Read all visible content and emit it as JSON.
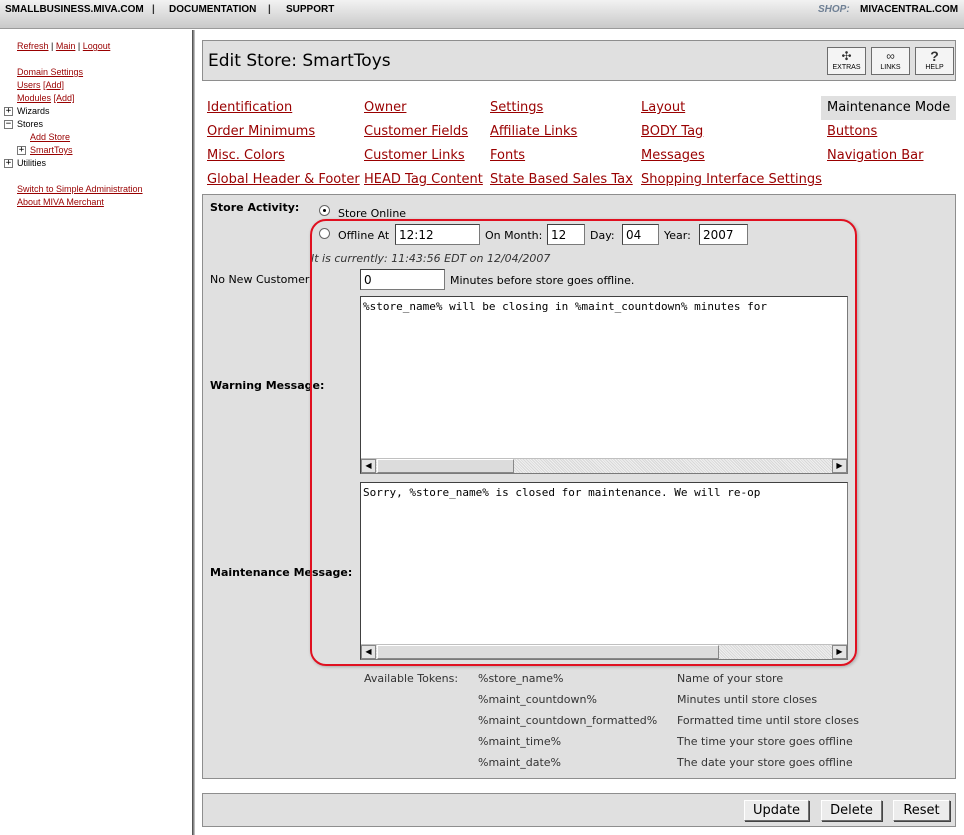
{
  "topbar": {
    "link1": "SMALLBUSINESS.MIVA.COM",
    "sep": "|",
    "link2": "DOCUMENTATION",
    "link3": "SUPPORT",
    "shop_label": "SHOP:",
    "shop_link": "MIVACENTRAL.COM"
  },
  "sidebar": {
    "refresh": "Refresh",
    "pipe": "|",
    "main": "Main",
    "logout": "Logout",
    "domain_settings": "Domain Settings",
    "users": "Users",
    "users_add": "[Add]",
    "modules": "Modules",
    "modules_add": "[Add]",
    "wizards": "Wizards",
    "stores": "Stores",
    "add_store": "Add Store",
    "smarttoys": "SmartToys",
    "utilities": "Utilities",
    "switch_simple": "Switch to Simple Administration",
    "about": "About MIVA Merchant",
    "plus_symbol": "+",
    "minus_symbol": "−"
  },
  "header": {
    "title": "Edit Store: SmartToys",
    "extras": "EXTRAS",
    "links": "LINKS",
    "help": "HELP",
    "help_icon": "?"
  },
  "tabs": {
    "identification": "Identification",
    "owner": "Owner",
    "settings": "Settings",
    "layout": "Layout",
    "maintenance_mode": "Maintenance Mode",
    "order_minimums": "Order Minimums",
    "customer_fields": "Customer Fields",
    "affiliate_links": "Affiliate Links",
    "body_tag": "BODY Tag",
    "buttons": "Buttons",
    "misc_colors": "Misc. Colors",
    "customer_links": "Customer Links",
    "fonts": "Fonts",
    "messages": "Messages",
    "navigation_bar": "Navigation Bar",
    "global_header_footer": "Global Header & Footer",
    "head_tag_content": "HEAD Tag Content",
    "state_based_sales_tax": "State Based Sales Tax",
    "shopping_interface_settings": "Shopping Interface Settings"
  },
  "form": {
    "store_activity_label": "Store Activity:",
    "store_online_label": "Store Online",
    "offline_at_label": "Offline At",
    "offline_at_value": "12:12",
    "on_month_label": "On Month:",
    "month_value": "12",
    "day_label": "Day:",
    "day_value": "04",
    "year_label": "Year:",
    "year_value": "2007",
    "current_time": "It is currently: 11:43:56 EDT on 12/04/2007",
    "no_new_customer_label": "No New Customer:",
    "no_new_customer_value": "0",
    "minutes_label": "Minutes before store goes offline.",
    "warning_label": "Warning Message:",
    "warning_value": "%store_name% will be closing in %maint_countdown% minutes for",
    "maintenance_label": "Maintenance Message:",
    "maintenance_value": "Sorry, %store_name% is closed for maintenance.  We will re-op",
    "store_activity_selected": "Store Online"
  },
  "tokens": {
    "label": "Available Tokens:",
    "items": [
      {
        "token": "%store_name%",
        "desc": "Name of your store"
      },
      {
        "token": "%maint_countdown%",
        "desc": "Minutes until store closes"
      },
      {
        "token": "%maint_countdown_formatted%",
        "desc": "Formatted time until store closes"
      },
      {
        "token": "%maint_time%",
        "desc": "The time your store goes offline"
      },
      {
        "token": "%maint_date%",
        "desc": "The date your store goes offline"
      }
    ]
  },
  "footer": {
    "update": "Update",
    "delete": "Delete",
    "reset": "Reset"
  },
  "colors": {
    "link": "#990000",
    "panel_bg": "#e0e0e0",
    "highlight": "#e01020"
  }
}
